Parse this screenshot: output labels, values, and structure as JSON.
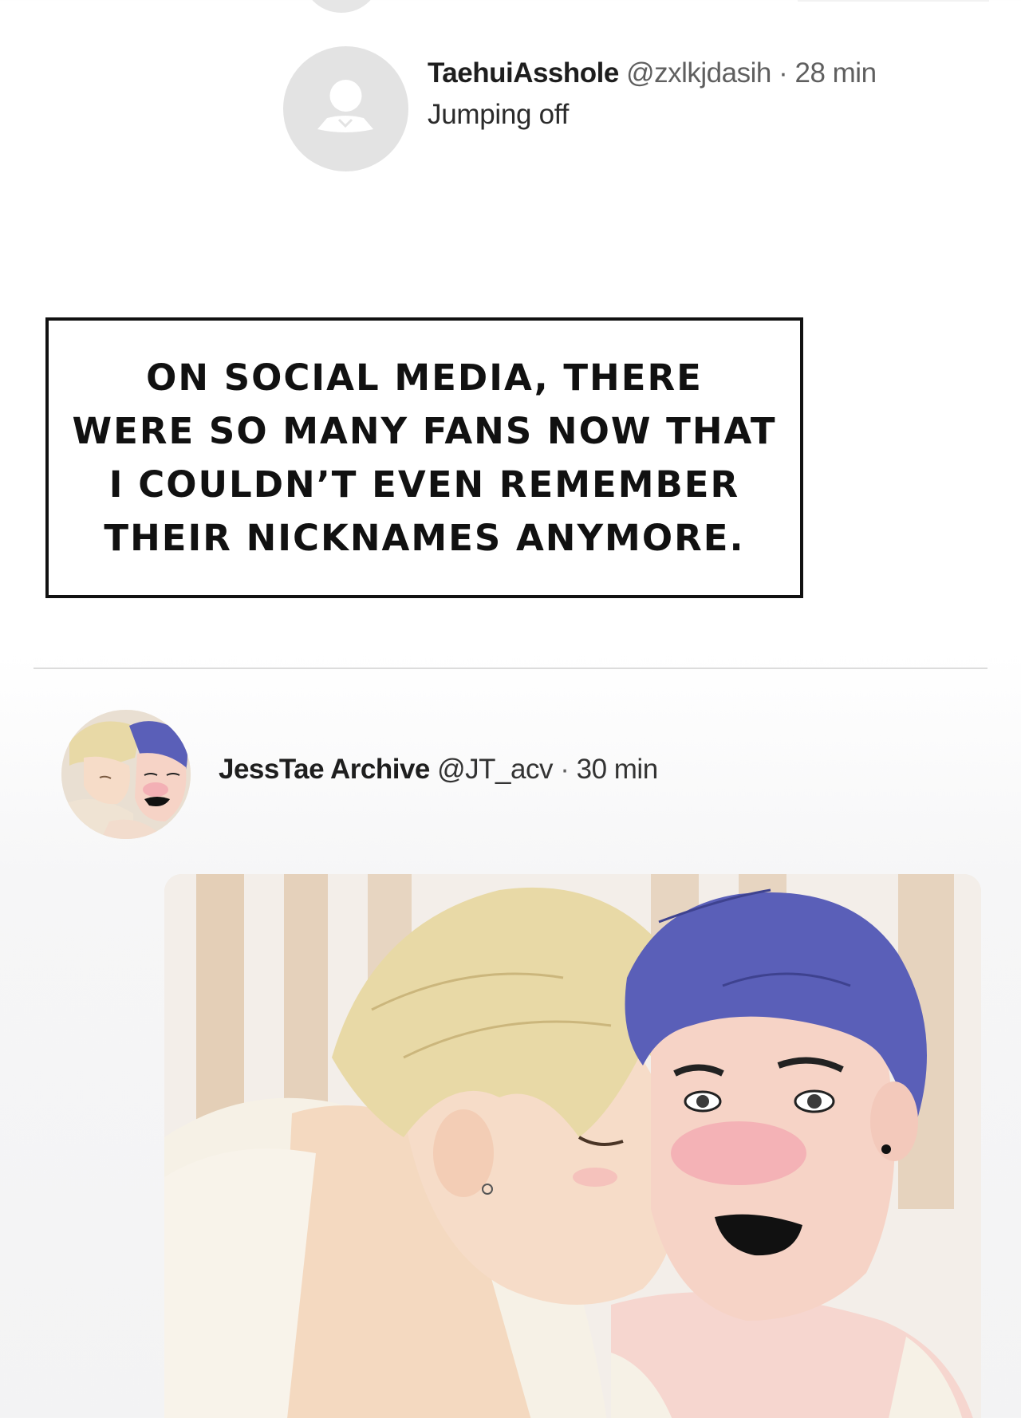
{
  "posts": [
    {
      "author_name": "TaehuiAsshole",
      "handle": "@zxlkjdasih",
      "separator": "·",
      "time": "28 min",
      "text": "Jumping off"
    },
    {
      "author_name": "JessTae Archive",
      "handle": "@JT_acv",
      "separator": "·",
      "time": "30 min"
    }
  ],
  "caption": {
    "lines": [
      "ON SOCIAL MEDIA, THERE",
      "WERE SO MANY FANS NOW THAT",
      "I COULDN’T EVEN REMEMBER",
      "THEIR NICKNAMES ANYMORE."
    ]
  },
  "colors": {
    "placeholder_avatar": "#e3e3e3",
    "caption_border": "#111111",
    "blond_hair": "#e8d9a6",
    "blue_hair": "#5a5fb8",
    "skin": "#f6dcc8",
    "blush": "#f3a7b0",
    "wood_stripe": "#d8b894"
  },
  "icons": [
    "person-placeholder-icon"
  ]
}
